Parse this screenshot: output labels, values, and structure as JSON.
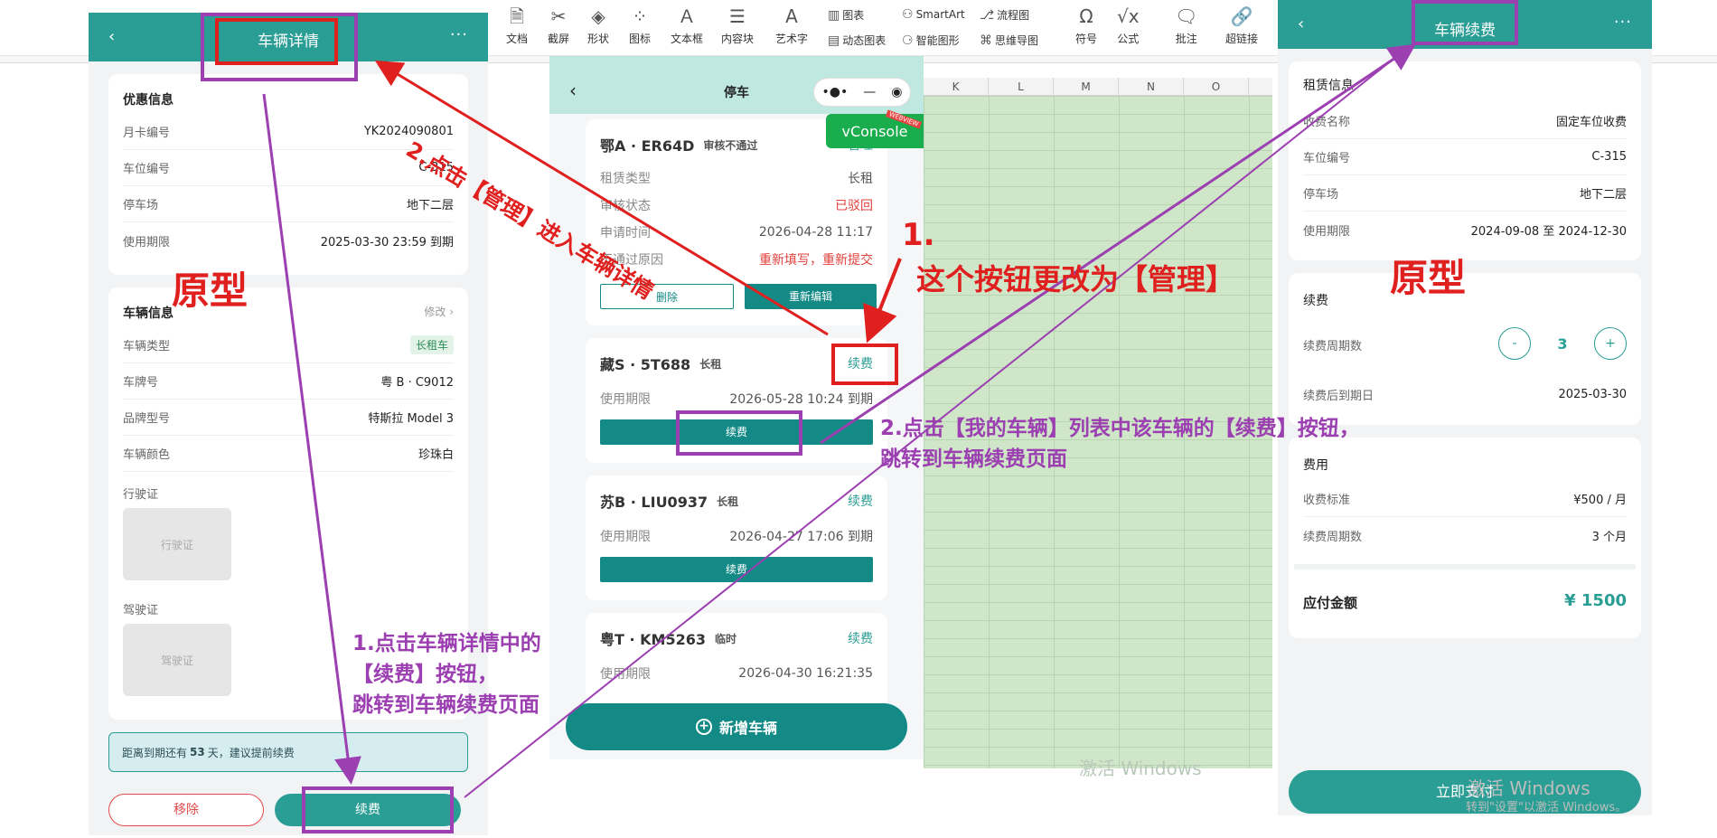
{
  "ribbon": {
    "items": [
      "文档",
      "截屏",
      "形状",
      "图标",
      "文本框",
      "内容块",
      "艺术字",
      "符号",
      "公式",
      "批注",
      "超链接"
    ],
    "small": [
      "图表",
      "动态图表",
      "SmartArt",
      "智能图形",
      "流程图",
      "思维导图"
    ]
  },
  "sheet": {
    "columns": [
      "K",
      "L",
      "M",
      "N",
      "O"
    ],
    "watermark": "激活 Windows"
  },
  "left": {
    "nav_title": "车辆详情",
    "nav_back": "‹",
    "nav_more": "···",
    "discount": {
      "title": "优惠信息",
      "rows": [
        {
          "k": "月卡编号",
          "v": "YK2024090801"
        },
        {
          "k": "车位编号",
          "v": "C-315"
        },
        {
          "k": "停车场",
          "v": "地下二层"
        },
        {
          "k": "使用期限",
          "v": "2025-03-30 23:59 到期"
        }
      ]
    },
    "vehicle": {
      "title": "车辆信息",
      "edit": "修改 ›",
      "type_label": "车辆类型",
      "type_tag": "长租车",
      "rows": [
        {
          "k": "车牌号",
          "v": "粤 B · C9012"
        },
        {
          "k": "品牌型号",
          "v": "特斯拉 Model 3"
        },
        {
          "k": "车辆颜色",
          "v": "珍珠白"
        }
      ],
      "license_label": "行驶证",
      "license_photo": "行驶证",
      "driver_label": "驾驶证",
      "driver_photo": "驾驶证"
    },
    "notice_pre": "距离到期还有",
    "notice_days": "53",
    "notice_post": "天，建议提前续费",
    "remove_btn": "移除",
    "renew_btn": "续费"
  },
  "mid": {
    "nav_title": "停车",
    "nav_back": "‹",
    "capsule_dots": "•●•",
    "capsule_minus": "—",
    "capsule_target": "◉",
    "vconsole": "vConsole",
    "vconsole_tag": "WEBVIEW",
    "cards": [
      {
        "plate": "鄂A · ER64D",
        "sub": "审核不通过",
        "action": "管理",
        "rows": [
          {
            "k": "租赁类型",
            "v": "长租",
            "red": false
          },
          {
            "k": "审核状态",
            "v": "已驳回",
            "red": true
          },
          {
            "k": "申请时间",
            "v": "2026-04-28 11:17",
            "red": false
          },
          {
            "k": "不通过原因",
            "v": "重新填写，重新提交",
            "red": true
          }
        ],
        "btn_delete": "删除",
        "btn_edit": "重新编辑"
      },
      {
        "plate": "藏S · 5T688",
        "sub": "长租",
        "action": "续费",
        "rows": [
          {
            "k": "使用期限",
            "v": "2026-05-28 10:24 到期"
          }
        ],
        "btn": "续费"
      },
      {
        "plate": "苏B · LIU0937",
        "sub": "长租",
        "action": "续费",
        "rows": [
          {
            "k": "使用期限",
            "v": "2026-04-27 17:06 到期"
          }
        ],
        "btn": "续费"
      },
      {
        "plate": "粤T · KM5263",
        "sub": "临时",
        "action": "续费",
        "rows": [
          {
            "k": "使用期限",
            "v": "2026-04-30 16:21:35"
          }
        ]
      }
    ],
    "add_btn": "新增车辆",
    "add_icon": "+"
  },
  "right": {
    "nav_title": "车辆续费",
    "nav_back": "‹",
    "nav_more": "···",
    "lease": {
      "title": "租赁信息",
      "rows": [
        {
          "k": "收费名称",
          "v": "固定车位收费"
        },
        {
          "k": "车位编号",
          "v": "C-315"
        },
        {
          "k": "停车场",
          "v": "地下二层"
        },
        {
          "k": "使用期限",
          "v": "2024-09-08 至 2024-12-30"
        }
      ]
    },
    "renew": {
      "title": "续费",
      "period_label": "续费周期数",
      "minus": "-",
      "value": "3",
      "plus": "+",
      "after_label": "续费后到期日",
      "after_value": "2025-03-30"
    },
    "fee": {
      "title": "费用",
      "rows": [
        {
          "k": "收费标准",
          "v": "¥500 / 月"
        },
        {
          "k": "续费周期数",
          "v": "3 个月"
        }
      ],
      "total_label": "应付金额",
      "total_value": "¥ 1500"
    },
    "pay_btn": "立即支付",
    "watermark": "激活 Windows",
    "watermark_sub": "转到\"设置\"以激活 Windows。"
  },
  "annotations": {
    "proto_left": "原型",
    "proto_right": "原型",
    "red_step1_num": "1.",
    "red_step1_text": "这个按钮更改为【管理】",
    "red_step2": "2.点击【管理】进入车辆详情",
    "purple_step2_line1": "2.点击【我的车辆】列表中该车辆的【续费】按钮，",
    "purple_step2_line2": "跳转到车辆续费页面",
    "purple_step1_line1": "1.点击车辆详情中的",
    "purple_step1_line2": "【续费】按钮，",
    "purple_step1_line3": "跳转到车辆续费页面"
  },
  "colors": {
    "teal": "#2a9d94",
    "annotation_red": "#e0201f",
    "annotation_purple": "#9b3fb1"
  }
}
